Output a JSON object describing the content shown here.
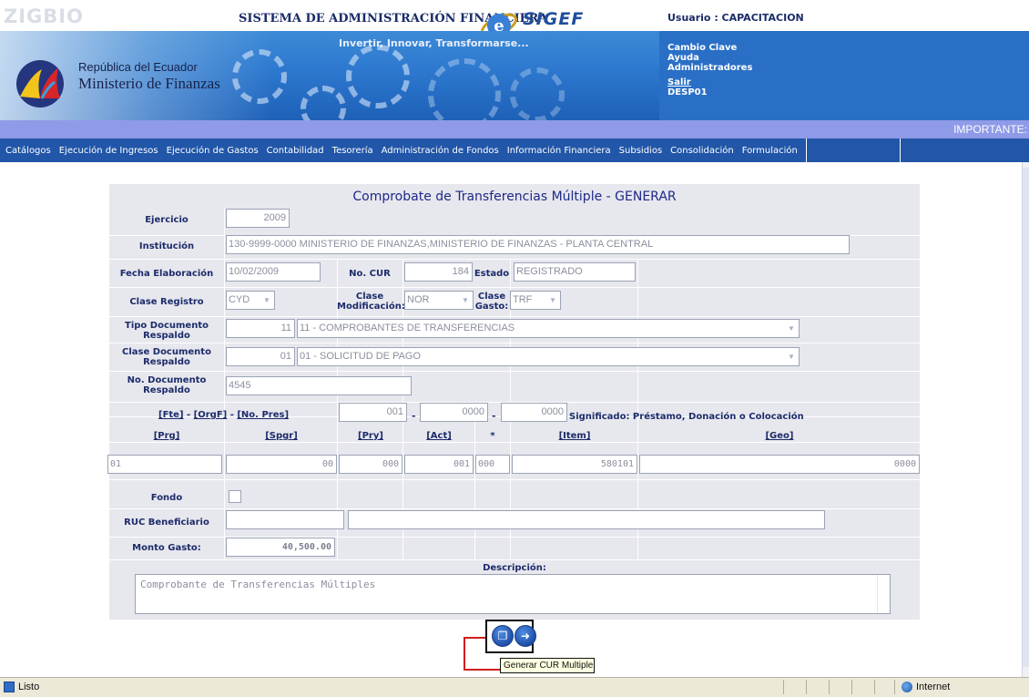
{
  "header": {
    "system_title": "SISTEMA DE ADMINISTRACIÓN FINANCIERA",
    "sigef_logo": "SIGEF",
    "slogan": "Invertir, Innovar, Transformarse...",
    "user_label": "Usuario : CAPACITACION",
    "republic": "República del Ecuador",
    "ministry": "Ministerio de Finanzas",
    "links": {
      "cambio_clave": "Cambio Clave",
      "ayuda": "Ayuda",
      "administradores": "Administradores",
      "salir": "Salir",
      "desp": "DESP01"
    },
    "importante": "IMPORTANTE:"
  },
  "menu": {
    "items": [
      "Catálogos",
      "Ejecución de Ingresos",
      "Ejecución de Gastos",
      "Contabilidad",
      "Tesorería",
      "Administración de Fondos",
      "Información Financiera",
      "Subsidios",
      "Consolidación",
      "Formulación"
    ]
  },
  "form": {
    "title": "Comprobate de Transferencias Múltiple - GENERAR",
    "ejercicio": {
      "label": "Ejercicio",
      "value": "2009"
    },
    "institucion": {
      "label": "Institución",
      "value": "130-9999-0000  MINISTERIO DE FINANZAS,MINISTERIO DE FINANZAS - PLANTA CENTRAL"
    },
    "fecha_elaboracion": {
      "label": "Fecha Elaboración",
      "value": "10/02/2009"
    },
    "no_cur": {
      "label": "No. CUR",
      "value": "184"
    },
    "estado": {
      "label": "Estado",
      "value": "REGISTRADO"
    },
    "clase_registro": {
      "label": "Clase Registro",
      "value": "CYD"
    },
    "clase_modificacion": {
      "label": "Clase Modificación:",
      "value": "NOR"
    },
    "clase_gasto": {
      "label": "Clase Gasto:",
      "value": "TRF"
    },
    "tipo_documento": {
      "label": "Tipo Documento Respaldo",
      "code": "11",
      "value": "11 - COMPROBANTES DE TRANSFERENCIAS"
    },
    "clase_documento": {
      "label": "Clase Documento Respaldo",
      "code": "01",
      "value": "01 - SOLICITUD DE PAGO"
    },
    "no_documento": {
      "label": "No. Documento Respaldo",
      "value": "4545"
    },
    "fuente_links": {
      "fte": "[Fte]",
      "sep1": " - ",
      "orgf": "[OrgF]",
      "sep2": " - ",
      "no_pres": "[No. Pres]"
    },
    "fte_value": "001",
    "orgf_value": "0000",
    "nopres_value": "0000",
    "dash1": "-",
    "dash2": "-",
    "significado": "Significado: Préstamo, Donación o Colocación",
    "columns": {
      "prg": "[Prg]",
      "spgr": "[Spgr]",
      "pry": "[Pry]",
      "act": "[Act]",
      "star": "*",
      "item": "[Item]",
      "geo": "[Geo]"
    },
    "row": {
      "prg": "01",
      "spgr": "00",
      "pry": "000",
      "act": "001",
      "star": "000",
      "item": "580101",
      "geo": "0000"
    },
    "fondo": {
      "label": "Fondo"
    },
    "ruc": {
      "label": "RUC Beneficiario",
      "value": "",
      "name": ""
    },
    "monto": {
      "label": "Monto Gasto:",
      "value": "40,500.00"
    },
    "descripcion": {
      "label": "Descripción:",
      "value": "Comprobante de Transferencias Múltiples"
    }
  },
  "actions": {
    "generate_icon_name": "copy-document-icon",
    "exit_icon_name": "exit-icon",
    "tooltip": "Generar CUR Multiple"
  },
  "statusbar": {
    "status": "Listo",
    "zone": "Internet"
  }
}
